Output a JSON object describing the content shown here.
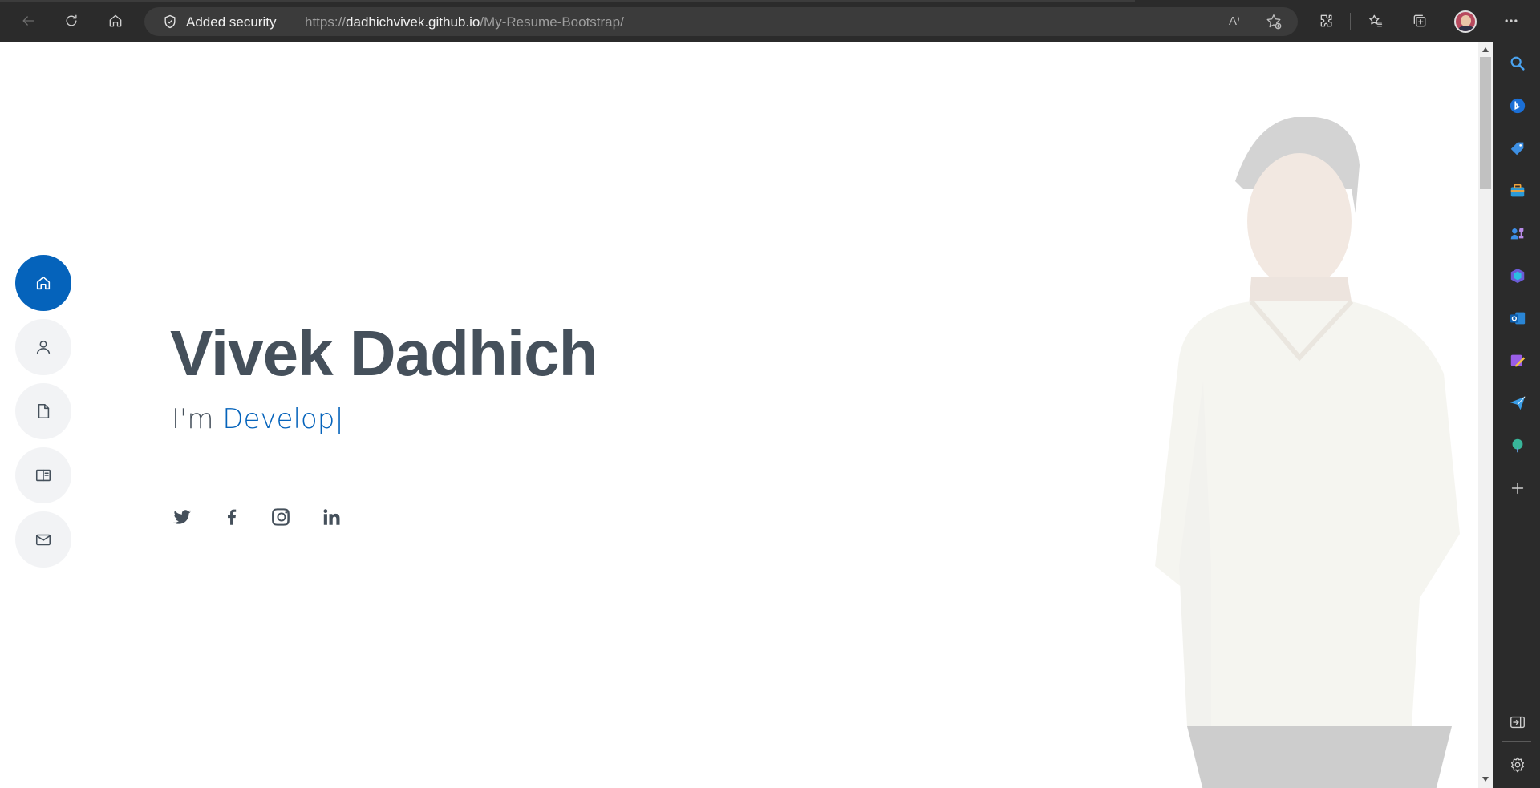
{
  "browser": {
    "security_label": "Added security",
    "url_scheme": "https://",
    "url_host": "dadhichvivek.github.io",
    "url_path": "/My-Resume-Bootstrap/",
    "read_aloud_label": "A⁾",
    "toolbar_icons": [
      "back-icon",
      "refresh-icon",
      "home-icon",
      "shield-icon",
      "read-aloud-icon",
      "add-favorite-icon",
      "extensions-icon",
      "favorites-icon",
      "collections-icon",
      "profile-avatar",
      "more-icon"
    ]
  },
  "page": {
    "name": "Vivek Dadhich",
    "subtitle_prefix": "I'm ",
    "subtitle_typed": "Develop",
    "subtitle_cursor": "|",
    "accent_color": "#0563bb",
    "text_color": "#45505b",
    "nav_items": [
      {
        "icon": "home-icon",
        "active": true
      },
      {
        "icon": "person-icon",
        "active": false
      },
      {
        "icon": "file-icon",
        "active": false
      },
      {
        "icon": "book-icon",
        "active": false
      },
      {
        "icon": "envelope-icon",
        "active": false
      }
    ],
    "social_links": [
      "twitter-icon",
      "facebook-icon",
      "instagram-icon",
      "linkedin-icon"
    ]
  },
  "edge_sidebar": {
    "icons": [
      "search-icon",
      "bing-icon",
      "shopping-tag-icon",
      "tools-icon",
      "games-icon",
      "microsoft365-icon",
      "outlook-icon",
      "designer-icon",
      "drop-icon",
      "tree-icon",
      "add-icon",
      "sidebar-toggle-icon",
      "settings-icon"
    ]
  }
}
